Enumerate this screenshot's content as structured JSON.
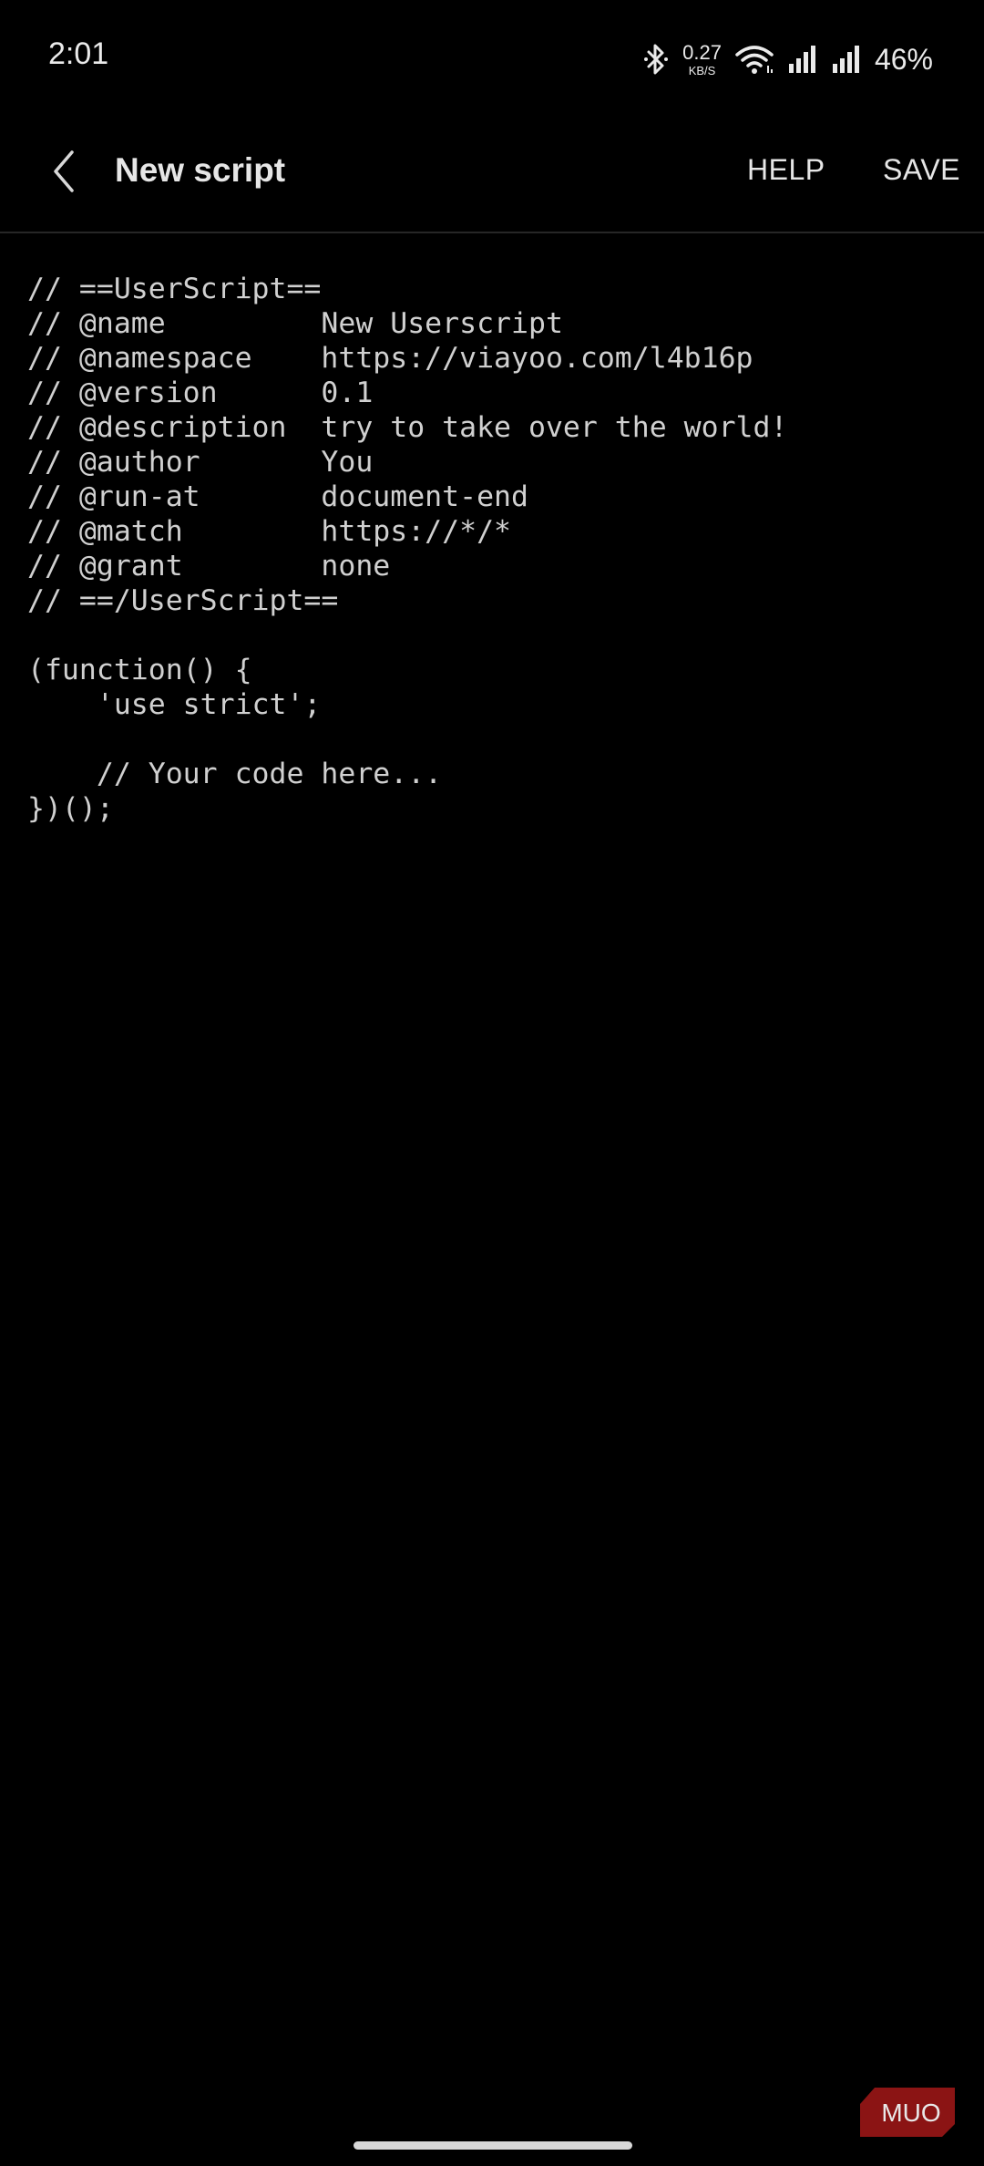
{
  "status_bar": {
    "time": "2:01",
    "net_speed_value": "0.27",
    "net_speed_unit": "KB/S",
    "battery": "46%"
  },
  "app_bar": {
    "title": "New script",
    "help_label": "HELP",
    "save_label": "SAVE"
  },
  "editor": {
    "code": "// ==UserScript==\n// @name         New Userscript\n// @namespace    https://viayoo.com/l4b16p\n// @version      0.1\n// @description  try to take over the world!\n// @author       You\n// @run-at       document-end\n// @match        https://*/*\n// @grant        none\n// ==/UserScript==\n\n(function() {\n    'use strict';\n\n    // Your code here...\n})();"
  },
  "watermark": {
    "text": "MUO"
  },
  "colors": {
    "background": "#000000",
    "text": "#e6e6e6",
    "watermark": "#8b1414"
  },
  "icons": {
    "back": "chevron-left-icon",
    "bluetooth": "bluetooth-icon",
    "wifi": "wifi-icon",
    "signal": "cell-signal-icon"
  }
}
